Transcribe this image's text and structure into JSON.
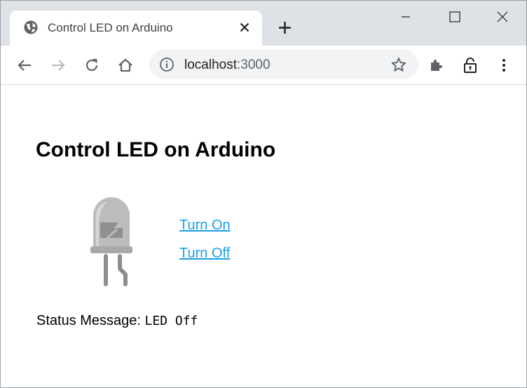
{
  "browser": {
    "tab": {
      "title": "Control LED on Arduino",
      "favicon": "globe-icon"
    },
    "address_bar": {
      "url_host": "localhost",
      "url_port": ":3000"
    }
  },
  "page": {
    "heading": "Control LED on Arduino",
    "led": {
      "state": "off",
      "color": "#a0a0a0"
    },
    "links": {
      "turn_on": "Turn On",
      "turn_off": "Turn Off"
    },
    "status": {
      "label": "Status Message:",
      "value": "LED Off"
    }
  },
  "colors": {
    "link": "#1a9fe6",
    "tabstrip": "#dee1e6",
    "omnibox": "#f1f3f4"
  }
}
